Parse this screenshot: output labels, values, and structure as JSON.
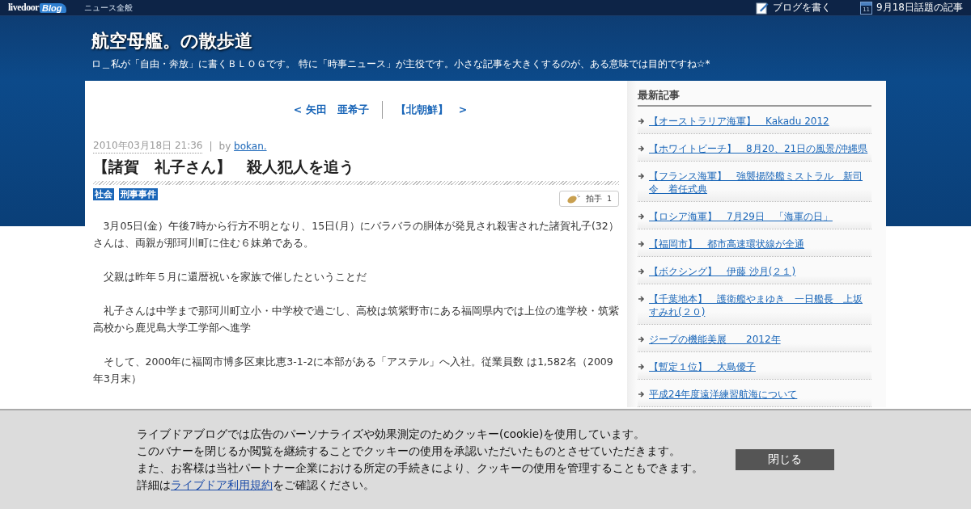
{
  "topbar": {
    "logo_main": "livedoor",
    "logo_script": "Blog",
    "category": "ニュース全般",
    "actions": [
      {
        "kind": "write",
        "label": "ブログを書く"
      },
      {
        "kind": "calendar",
        "label": "9月18日話題の記事",
        "day": "11"
      }
    ]
  },
  "blog": {
    "title": "航空母艦。の散歩道",
    "description": "ロ＿私が「自由・奔放」に書くＢＬＯＧです。 特に「時事ニュース」が主役です。小さな記事を大きくするのが、ある意味では目的ですね☆*"
  },
  "pager": {
    "prev": "< 矢田　亜希子",
    "next": "【北朝鮮】　>"
  },
  "article": {
    "date": "2010年03月18日 21:36",
    "separator": "|",
    "by": "by",
    "author": "bokan.",
    "title": "【諸賀　礼子さん】　殺人犯人を追う",
    "tags": [
      "社会",
      "刑事事件"
    ],
    "clap": {
      "label": "拍手",
      "count": "1"
    },
    "paragraphs": [
      "3月05日(金）午後7時から行方不明となり、15日(月）にバラバラの胴体が発見され殺害された諸賀礼子(32）さんは、両親が那珂川町に住む６妹弟である。",
      "父親は昨年５月に還暦祝いを家族で催したということだ",
      "礼子さんは中学まで那珂川町立小・中学校で過ごし、高校は筑紫野市にある福岡県内では上位の進学校・筑紫高校から鹿児島大学工学部へ進学",
      "そして、2000年に福岡市博多区東比恵3-1-2に本部がある「アステル」へ入社。従業員数 は1,582名（2009年3月末）"
    ]
  },
  "sidebar": {
    "heading": "最新記事",
    "items": [
      "【オーストラリア海軍】　Kakadu 2012",
      "【ホワイトビーチ】　8月20、21日の風景/沖縄県",
      "【フランス海軍】　強襲揚陸艦ミストラル　新司令　着任式典",
      "【ロシア海軍】　7月29日　「海軍の日」",
      "【福岡市】　都市高速環状線が全通",
      "【ボクシング】　伊藤 沙月(２１)",
      "【千葉地本】　護衛艦やまゆき　一日艦長　上坂すみれ(２０)",
      "ジープの機能美展　　2012年",
      "【暫定１位】　大島優子",
      "平成24年度遠洋練習航海について"
    ]
  },
  "cookie_banner": {
    "lines": [
      "ライブドアブログでは広告のパーソナライズや効果測定のためクッキー(cookie)を使用しています。",
      "このバナーを閉じるか閲覧を継続することでクッキーの使用を承認いただいたものとさせていただきます。",
      "また、お客様は当社パートナー企業における所定の手続きにより、クッキーの使用を管理することもできます。"
    ],
    "detail_before": "詳細は",
    "detail_link": "ライブドア利用規約",
    "detail_after": "をご確認ください。",
    "close": "閉じる"
  }
}
